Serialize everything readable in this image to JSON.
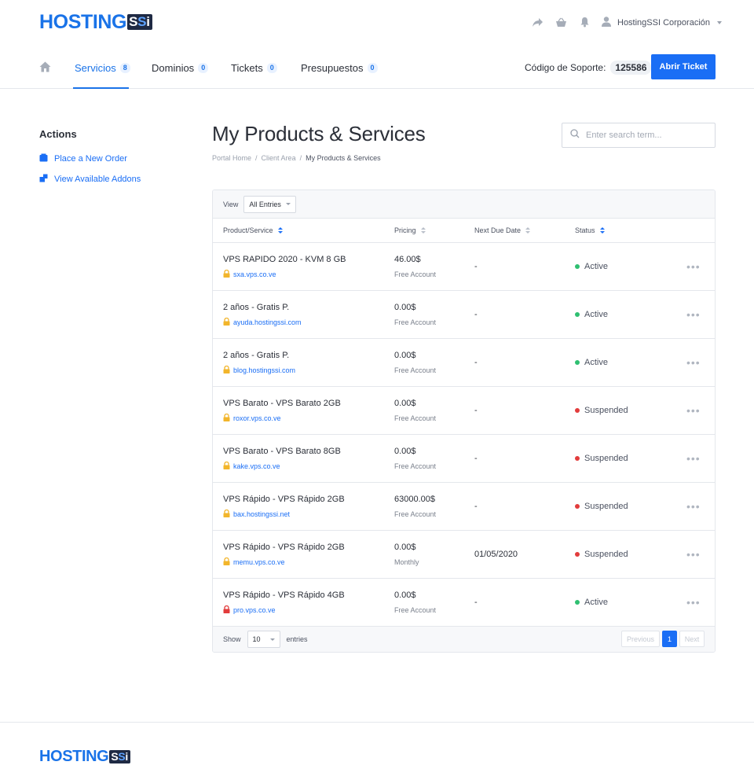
{
  "brand": {
    "name_main": "HOSTING",
    "name_badge_s1": "S",
    "name_badge_s2": "S",
    "name_badge_i": "i"
  },
  "header": {
    "user_name": "HostingSSI Corporación",
    "icons": [
      "share-icon",
      "basket-icon",
      "bell-icon",
      "user-icon"
    ]
  },
  "nav": {
    "items": [
      {
        "label": "Servicios",
        "count": "8"
      },
      {
        "label": "Dominios",
        "count": "0"
      },
      {
        "label": "Tickets",
        "count": "0"
      },
      {
        "label": "Presupuestos",
        "count": "0"
      }
    ],
    "support_label": "Código de Soporte:",
    "support_code": "125586",
    "ticket_button": "Abrir Ticket"
  },
  "sidebar": {
    "title": "Actions",
    "links": [
      {
        "label": "Place a New Order",
        "icon": "basket-icon"
      },
      {
        "label": "View Available Addons",
        "icon": "addons-icon"
      }
    ]
  },
  "main": {
    "title": "My Products & Services",
    "search_placeholder": "Enter search term...",
    "breadcrumb": [
      "Portal Home",
      "Client Area",
      "My Products & Services"
    ],
    "breadcrumb_sep": "/",
    "view_label": "View",
    "view_value": "All Entries",
    "columns": [
      "Product/Service",
      "Pricing",
      "Next Due Date",
      "Status"
    ],
    "rows": [
      {
        "product": "VPS RAPIDO 2020 - KVM 8 GB",
        "domain": "sxa.vps.co.ve",
        "lock": "yellow",
        "price": "46.00$",
        "cycle": "Free Account",
        "due": "-",
        "status": "Active"
      },
      {
        "product": "2 años - Gratis P.",
        "domain": "ayuda.hostingssi.com",
        "lock": "yellow",
        "price": "0.00$",
        "cycle": "Free Account",
        "due": "-",
        "status": "Active"
      },
      {
        "product": "2 años - Gratis P.",
        "domain": "blog.hostingssi.com",
        "lock": "yellow",
        "price": "0.00$",
        "cycle": "Free Account",
        "due": "-",
        "status": "Active"
      },
      {
        "product": "VPS Barato - VPS Barato 2GB",
        "domain": "roxor.vps.co.ve",
        "lock": "yellow",
        "price": "0.00$",
        "cycle": "Free Account",
        "due": "-",
        "status": "Suspended"
      },
      {
        "product": "VPS Barato - VPS Barato 8GB",
        "domain": "kake.vps.co.ve",
        "lock": "yellow",
        "price": "0.00$",
        "cycle": "Free Account",
        "due": "-",
        "status": "Suspended"
      },
      {
        "product": "VPS Rápido - VPS Rápido 2GB",
        "domain": "bax.hostingssi.net",
        "lock": "yellow",
        "price": "63000.00$",
        "cycle": "Free Account",
        "due": "-",
        "status": "Suspended"
      },
      {
        "product": "VPS Rápido - VPS Rápido 2GB",
        "domain": "memu.vps.co.ve",
        "lock": "yellow",
        "price": "0.00$",
        "cycle": "Monthly",
        "due": "01/05/2020",
        "status": "Suspended"
      },
      {
        "product": "VPS Rápido - VPS Rápido 4GB",
        "domain": "pro.vps.co.ve",
        "lock": "red",
        "price": "0.00$",
        "cycle": "Free Account",
        "due": "-",
        "status": "Active"
      }
    ],
    "more_glyph": "•••",
    "footer": {
      "show_label": "Show",
      "show_value": "10",
      "entries_label": "entries",
      "prev": "Previous",
      "page": "1",
      "next": "Next"
    }
  },
  "colors": {
    "accent": "#1a6ef5",
    "active": "#2fbf71",
    "suspended": "#e23c3c",
    "lock_yellow": "#f2b52b",
    "lock_red": "#e23c3c"
  }
}
